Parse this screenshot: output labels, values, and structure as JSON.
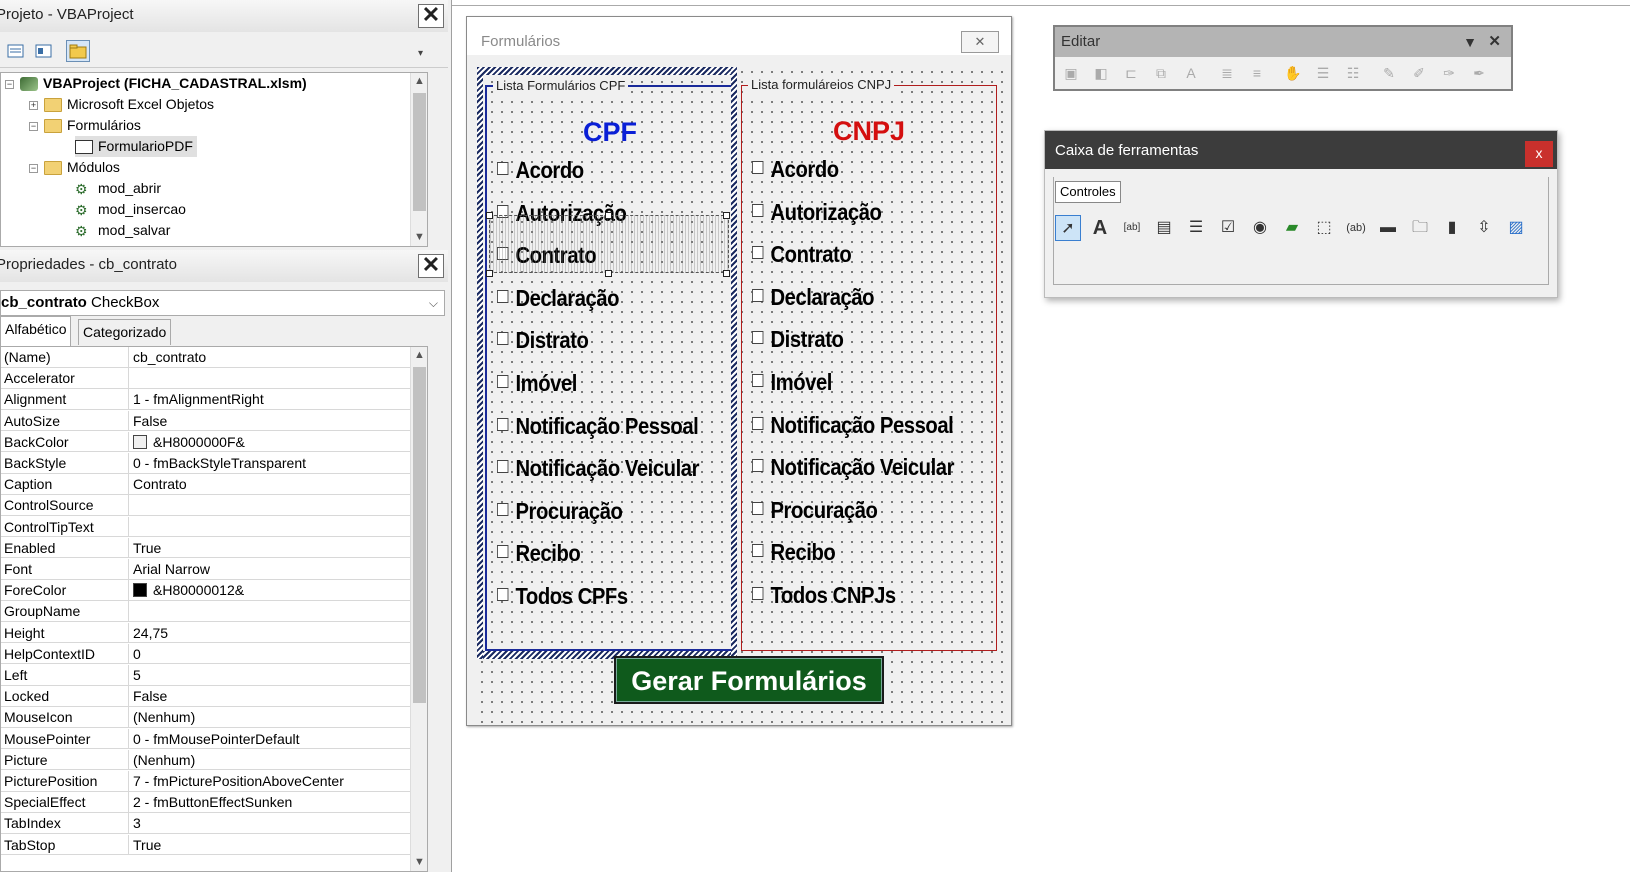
{
  "project": {
    "title": "Projeto - VBAProject",
    "tree": [
      {
        "label": "VBAProject (FICHA_CADASTRAL.xlsm)",
        "bold": true
      },
      {
        "label": "Microsoft Excel Objetos"
      },
      {
        "label": "Formulários"
      },
      {
        "label": "FormularioPDF"
      },
      {
        "label": "Módulos"
      },
      {
        "label": "mod_abrir"
      },
      {
        "label": "mod_insercao"
      },
      {
        "label": "mod_salvar"
      }
    ]
  },
  "properties": {
    "title": "Propriedades - cb_contrato",
    "object_name": "cb_contrato",
    "object_type": "CheckBox",
    "tabs": [
      "Alfabético",
      "Categorizado"
    ],
    "rows": [
      {
        "name": "(Name)",
        "value": "cb_contrato"
      },
      {
        "name": "Accelerator",
        "value": ""
      },
      {
        "name": "Alignment",
        "value": "1 - fmAlignmentRight"
      },
      {
        "name": "AutoSize",
        "value": "False"
      },
      {
        "name": "BackColor",
        "value": "&H8000000F&"
      },
      {
        "name": "BackStyle",
        "value": "0 - fmBackStyleTransparent"
      },
      {
        "name": "Caption",
        "value": "Contrato"
      },
      {
        "name": "ControlSource",
        "value": ""
      },
      {
        "name": "ControlTipText",
        "value": ""
      },
      {
        "name": "Enabled",
        "value": "True"
      },
      {
        "name": "Font",
        "value": "Arial Narrow"
      },
      {
        "name": "ForeColor",
        "value": "&H80000012&"
      },
      {
        "name": "GroupName",
        "value": ""
      },
      {
        "name": "Height",
        "value": "24,75"
      },
      {
        "name": "HelpContextID",
        "value": "0"
      },
      {
        "name": "Left",
        "value": "5"
      },
      {
        "name": "Locked",
        "value": "False"
      },
      {
        "name": "MouseIcon",
        "value": "(Nenhum)"
      },
      {
        "name": "MousePointer",
        "value": "0 - fmMousePointerDefault"
      },
      {
        "name": "Picture",
        "value": "(Nenhum)"
      },
      {
        "name": "PicturePosition",
        "value": "7 - fmPicturePositionAboveCenter"
      },
      {
        "name": "SpecialEffect",
        "value": "2 - fmButtonEffectSunken"
      },
      {
        "name": "TabIndex",
        "value": "3"
      },
      {
        "name": "TabStop",
        "value": "True"
      }
    ]
  },
  "form": {
    "title": "Formulários",
    "cpf_frame": "Lista Formulários CPF",
    "cnpj_frame": "Lista formuláreios CNPJ",
    "cpf_heading": "CPF",
    "cnpj_heading": "CNPJ",
    "cpf_items": [
      "Acordo",
      "Autorização",
      "Contrato",
      "Declaração",
      "Distrato",
      "Imóvel",
      "Notificação Pessoal",
      "Notificação Veicular",
      "Procuração",
      "Recibo",
      "Todos CPFs"
    ],
    "cnpj_items": [
      "Acordo",
      "Autorização",
      "Contrato",
      "Declaração",
      "Distrato",
      "Imóvel",
      "Notificação Pessoal",
      "Notificação Veicular",
      "Procuração",
      "Recibo",
      "Todos CNPJs"
    ],
    "button": "Gerar Formulários"
  },
  "editar": {
    "title": "Editar"
  },
  "toolbox": {
    "title": "Caixa de ferramentas",
    "tab": "Controles",
    "close": "x"
  },
  "colors": {
    "cpf": "#0a1fd6",
    "cnpj": "#d40f0f",
    "button_bg": "#0f5a1c"
  }
}
